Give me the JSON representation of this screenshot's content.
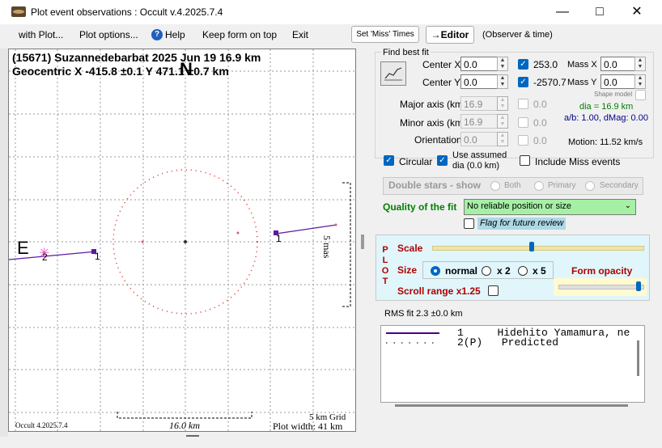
{
  "window": {
    "title": "Plot event observations : Occult v.4.2025.7.4"
  },
  "menu": {
    "with_plot": "with Plot...",
    "plot_options": "Plot options...",
    "help": "Help",
    "keep_on_top": "Keep form on top",
    "exit": "Exit",
    "set_miss": "Set 'Miss' Times",
    "editor": "→Editor",
    "observer_time": "(Observer & time)"
  },
  "plot": {
    "header_line1": "(15671) Suzannedebarbat  2025 Jun 19  16.9 km",
    "header_line2": "Geocentric X -415.8 ±0.1  Y 471.1 ±0.7 km",
    "north": "N",
    "east": "E",
    "chord_label_1": "1",
    "chord_label_2": "2",
    "chord_label_1b": "1",
    "scale_mas": "5 mas",
    "grid": "5 km Grid",
    "width_label": "Plot width: 41 km",
    "scale_bar": "16.0 km",
    "version": "Occult 4.2025.7.4"
  },
  "fit": {
    "group_title": "Find best fit",
    "center_x_label": "Center X",
    "center_x": "0.0",
    "center_y_label": "Center Y",
    "center_y": "0.0",
    "val_x": "253.0",
    "val_y": "-2570.7",
    "mass_x_label": "Mass X",
    "mass_x": "0.0",
    "mass_y_label": "Mass Y",
    "mass_y": "0.0",
    "shape_model": "Shape model",
    "major_label": "Major axis (km)",
    "major": "16.9",
    "minor_label": "Minor axis (km)",
    "minor": "16.9",
    "orient_label": "Orientation",
    "orient": "0.0",
    "zero1": "0.0",
    "zero2": "0.0",
    "zero3": "0.0",
    "dia": "dia = 16.9 km",
    "ab": "a/b: 1.00, dMag: 0.00",
    "motion": "Motion: 11.52 km/s",
    "circular": "Circular",
    "use_assumed": "Use assumed dia (0.0 km)",
    "include_miss": "Include Miss events"
  },
  "double_stars": {
    "title": "Double stars - show",
    "both": "Both",
    "primary": "Primary",
    "secondary": "Secondary"
  },
  "quality": {
    "label": "Quality of the fit",
    "value": "No reliable position or size",
    "flag": "Flag for future review"
  },
  "plotpanel": {
    "plot_letters": [
      "P",
      "L",
      "O",
      "T"
    ],
    "scale": "Scale",
    "size": "Size",
    "normal": "normal",
    "x2": "x 2",
    "x5": "x 5",
    "form_opacity": "Form opacity",
    "scroll_range": "Scroll range x1.25"
  },
  "rms": "RMS fit 2.3 ±0.0 km",
  "legend": [
    {
      "num": "1",
      "text": "Hidehito Yamamura, ne"
    },
    {
      "num": "2(P)",
      "text": "Predicted"
    }
  ],
  "colors": {
    "accent": "#0067c0",
    "quality_bg": "#a6f0a6",
    "chord": "#4b0082",
    "predicted": "#e00000",
    "plot_title": "#cc0000"
  }
}
